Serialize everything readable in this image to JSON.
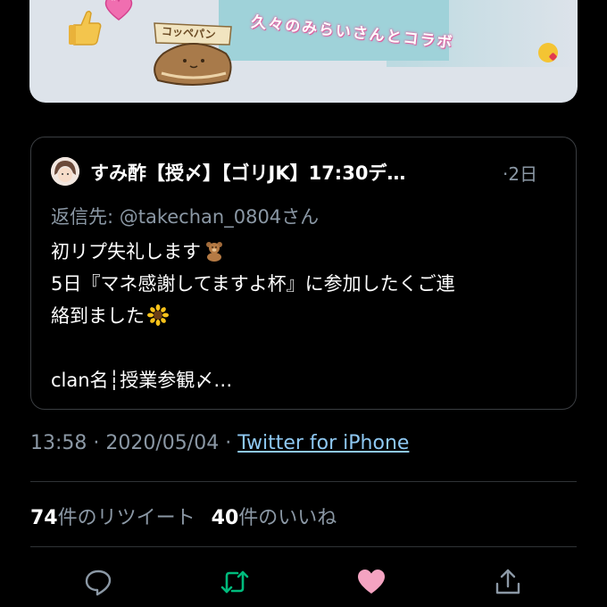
{
  "media": {
    "overlay_text": "久々のみらいさんとコラボ",
    "stamp_text": "コッペパン"
  },
  "quote": {
    "author": "すみ酢【授〆】【ゴリJK】17:30デ…",
    "time_ago": "·2日",
    "reply_to": "返信先: @takechan_0804さん",
    "body_lines": [
      "初リプ失礼します",
      "5日『マネ感謝してますよ杯』に参加したくご連",
      "絡到ました",
      "",
      "clan名┆授業参観〆…"
    ]
  },
  "meta": {
    "time": "13:58",
    "sep1": " · ",
    "date": "2020/05/04",
    "sep2": " · ",
    "source": "Twitter for iPhone"
  },
  "counts": {
    "retweets_num": "74",
    "retweets_label": "件のリツイート",
    "likes_num": "40",
    "likes_label": "件のいいね"
  },
  "colors": {
    "background": "#000000",
    "secondary_text": "#8b98a5",
    "link": "#8ec8f2",
    "retweet_active": "#00ba7c",
    "like_active": "#f4a3c1",
    "border": "#3a3d41"
  },
  "icons": {
    "reply": "reply-bubble-icon",
    "retweet": "retweet-icon",
    "like": "heart-icon",
    "share": "share-icon"
  }
}
